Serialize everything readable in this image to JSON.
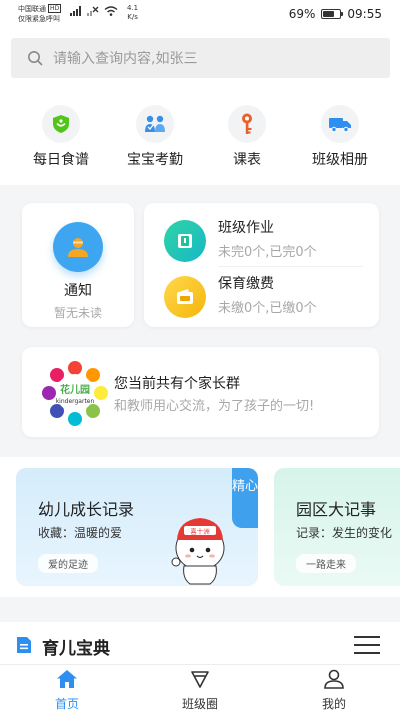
{
  "status_bar": {
    "carrier": "中国联通",
    "hd": "HD",
    "emergency": "仅限紧急呼叫",
    "net_speed": "4.1",
    "net_unit": "K/s",
    "battery_percent": "69%",
    "battery_level": 0.69,
    "time": "09:55"
  },
  "search": {
    "placeholder": "请输入查询内容,如张三"
  },
  "quick_actions": [
    {
      "label": "每日食谱",
      "icon": "meal-icon",
      "color": "#52c41a"
    },
    {
      "label": "宝宝考勤",
      "icon": "attendance-icon",
      "color": "#3a8ee6"
    },
    {
      "label": "课表",
      "icon": "key-icon",
      "color": "#e8602c"
    },
    {
      "label": "班级相册",
      "icon": "truck-icon",
      "color": "#2f8ff0"
    }
  ],
  "notice_card": {
    "title": "通知",
    "subtitle": "暂无未读"
  },
  "homework": {
    "title": "班级作业",
    "subtitle": "未完0个,已完0个"
  },
  "fees": {
    "title": "保育缴费",
    "subtitle": "未缴0个,已缴0个"
  },
  "parent_group": {
    "logo_text": "花儿园",
    "logo_subtext": "kindergarten",
    "title": "您当前共有个家长群",
    "subtitle": "和教师用心交流，为了孩子的一切!"
  },
  "records": [
    {
      "title": "幼儿成长记录",
      "subtitle": "收藏：温暖的爱",
      "pill": "爱的足迹",
      "badge": "精心"
    },
    {
      "title": "园区大记事",
      "subtitle": "记录：发生的变化",
      "pill": "一路走来"
    }
  ],
  "mascot_hat_text": "喜十洲",
  "section": {
    "title": "育儿宝典"
  },
  "tabs": [
    {
      "label": "首页",
      "active": true
    },
    {
      "label": "班级圈",
      "active": false
    },
    {
      "label": "我的",
      "active": false
    }
  ],
  "colors": {
    "accent": "#2f8ff0",
    "muted_text": "#a8a8a8"
  }
}
